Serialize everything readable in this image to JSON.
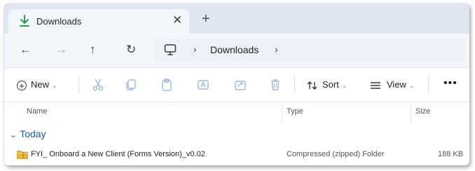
{
  "tab": {
    "title": "Downloads",
    "close": "✕",
    "new_tab": "+"
  },
  "nav": {
    "back": "←",
    "forward": "→",
    "up": "↑",
    "refresh": "↻"
  },
  "address": {
    "sep": "›",
    "location": "Downloads",
    "sep_end": "›"
  },
  "command_bar": {
    "new_label": "New",
    "sort_label": "Sort",
    "view_label": "View",
    "more_label": "•••",
    "chevron": "⌄"
  },
  "columns": {
    "name": "Name",
    "type": "Type",
    "size": "Size"
  },
  "group": {
    "chevron": "⌄",
    "label": "Today"
  },
  "files": [
    {
      "name": "FYI_ Onboard a New Client (Forms Version)_v0.02",
      "type": "Compressed (zipped) Folder",
      "size": "188 KB"
    }
  ],
  "colors": {
    "accent": "#1f5aa6",
    "tabstrip": "#dfe6f1",
    "disabled_icon": "#9eb8dd",
    "folder": "#e8b43a"
  }
}
